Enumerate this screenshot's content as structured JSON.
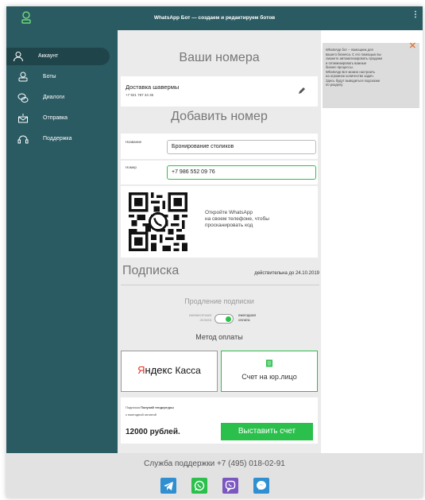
{
  "header": {
    "title": "WhatsApp Бот — создаем и редактируем ботов"
  },
  "sidebar": {
    "items": [
      {
        "label": "Аккаунт",
        "icon": "user-icon",
        "active": true
      },
      {
        "label": "Боты",
        "icon": "bot-icon"
      },
      {
        "label": "Диалоги",
        "icon": "chat-icon"
      },
      {
        "label": "Отправка",
        "icon": "send-icon"
      },
      {
        "label": "Поддержка",
        "icon": "support-icon"
      }
    ]
  },
  "numbers": {
    "title": "Ваши номера",
    "items": [
      {
        "name": "Доставка шавермы",
        "phone": "+7 921 787 34 36"
      }
    ]
  },
  "add": {
    "title": "Добавить номер",
    "name_label": "Название",
    "name_value": "Бронирование столиков",
    "number_label": "Номер",
    "number_value": "+7 986 552 09 76",
    "qr_text": [
      "Откройте WhatsApp",
      "на своем телефоне, чтобы",
      "просканировать код"
    ]
  },
  "subscription": {
    "title": "Подписка",
    "valid_until": "действительна до 24.10.2019",
    "renewal_title": "Продление подписки",
    "monthly_label": [
      "ежемесячная",
      "оплата"
    ],
    "yearly_label": [
      "ежегодная",
      "оплата"
    ],
    "yearly_selected": true,
    "payment_title": "Метод оплаты",
    "yandex_label": "Яндекс Касса",
    "yandex_first": "Я",
    "yandex_rest": "ндекс",
    "yandex_second": "Касса",
    "invoice_label": "Счет на юр.лицо",
    "summary_prefix": "Подписка",
    "summary_plan": "Получай тендертуры",
    "summary_period": "с ежегодной оплатой",
    "price": "12000 рублей.",
    "invoice_button": "Выставить счет"
  },
  "hint": {
    "lines": [
      "WhatsApp бот – помощник для",
      "вашего бизнеса. С его помощью вы",
      "сможете автоматизировать продажи",
      "и оптимизировать важные",
      "бизнес-процессы.",
      "WhatsApp Бот можно настроить",
      "на огромное количество задач.",
      "Здесь будут выводиться подсказки",
      "по разделу"
    ]
  },
  "footer": {
    "support": "Служба поддержки +7 (495) 018-02-91",
    "social": [
      {
        "icon": "telegram-icon",
        "color": "#2f8fd1"
      },
      {
        "icon": "whatsapp-icon",
        "color": "#2bbf4c"
      },
      {
        "icon": "viber-icon",
        "color": "#7b57c1"
      },
      {
        "icon": "messenger-icon",
        "color": "#2f8fd1"
      }
    ]
  },
  "colors": {
    "sidebar": "#2a5a62",
    "accent": "#2bbf4c",
    "close": "#e07a3c"
  }
}
